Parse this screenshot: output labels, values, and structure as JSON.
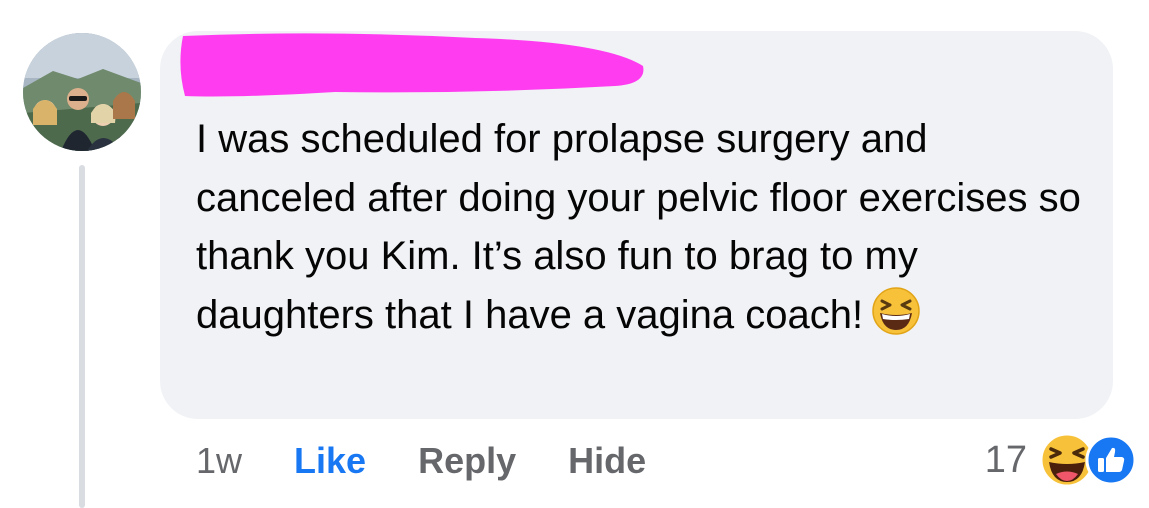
{
  "comment": {
    "text": "I was scheduled for prolapse surgery and canceled after doing your pelvic floor exercises so thank you Kim.  It’s also fun to brag to my daughters that I have a vagina coach!",
    "inline_emoji": "grinning-squinting-face"
  },
  "actions": {
    "timestamp": "1w",
    "like_label": "Like",
    "reply_label": "Reply",
    "hide_label": "Hide"
  },
  "reactions": {
    "count": "17",
    "types": [
      "haha",
      "like"
    ]
  },
  "colors": {
    "bubble": "#f0f2f5",
    "redaction": "#ff3cf0",
    "accent": "#1877f2",
    "secondary_text": "#65676b",
    "primary_text": "#050505"
  }
}
